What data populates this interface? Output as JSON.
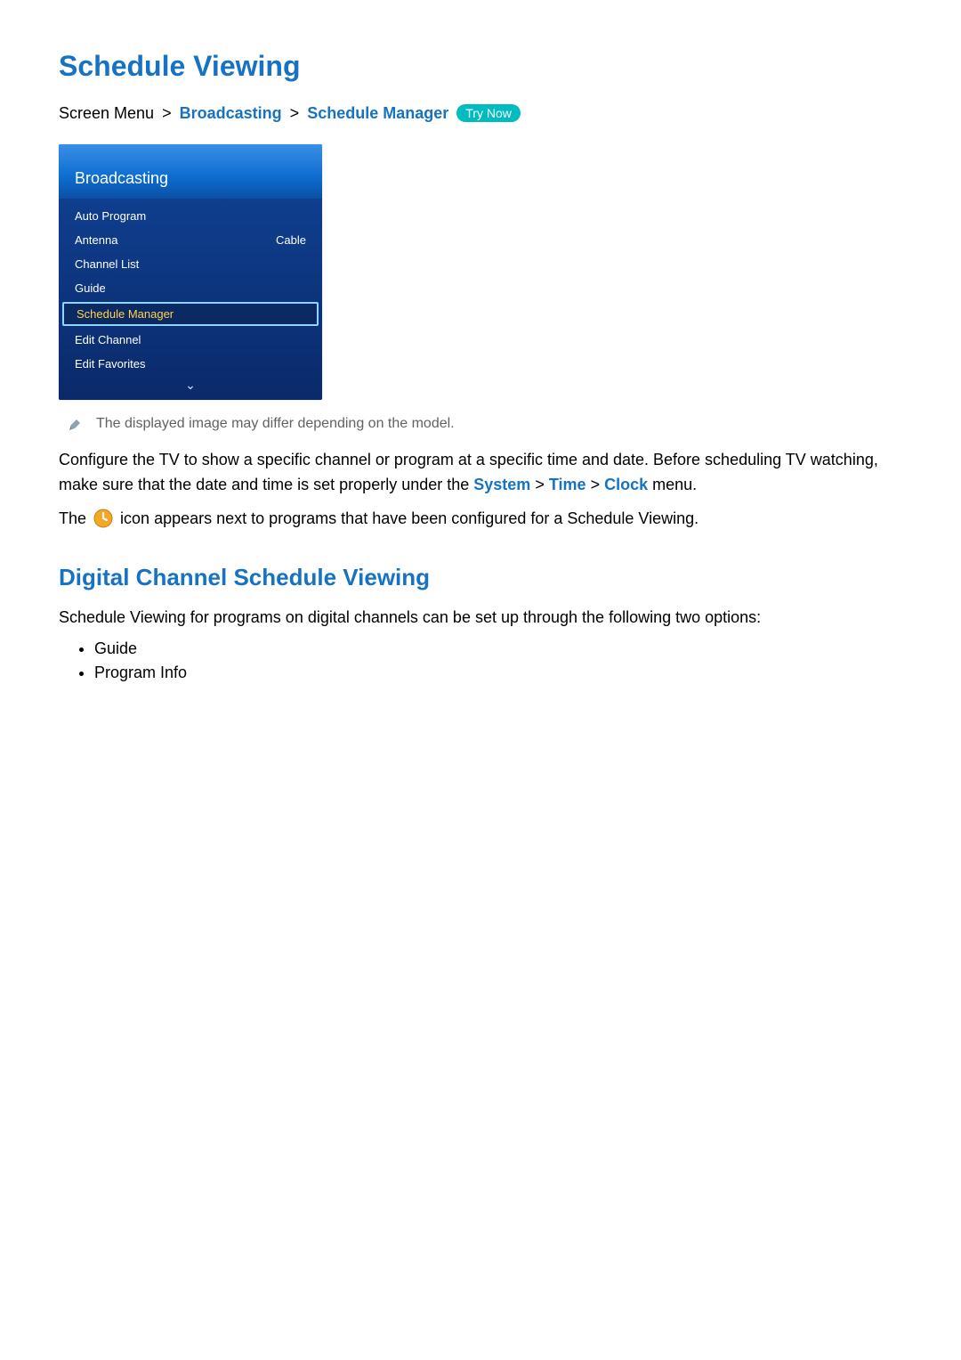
{
  "title": "Schedule Viewing",
  "breadcrumb": {
    "root": "Screen Menu",
    "sep": ">",
    "l1": "Broadcasting",
    "l2": "Schedule Manager",
    "try_now": "Try Now"
  },
  "tv_panel": {
    "header": "Broadcasting",
    "items": [
      {
        "label": "Auto Program",
        "value": ""
      },
      {
        "label": "Antenna",
        "value": "Cable"
      },
      {
        "label": "Channel List",
        "value": ""
      },
      {
        "label": "Guide",
        "value": ""
      },
      {
        "label": "Schedule Manager",
        "value": "",
        "selected": true
      },
      {
        "label": "Edit Channel",
        "value": ""
      },
      {
        "label": "Edit Favorites",
        "value": ""
      }
    ],
    "chevron": "⌄"
  },
  "note": "The displayed image may differ depending on the model.",
  "para1_a": "Configure the TV to show a specific channel or program at a specific time and date. Before scheduling TV watching, make sure that the date and time is set properly under the ",
  "para1_nav": {
    "a": "System",
    "sep": ">",
    "b": "Time",
    "c": "Clock"
  },
  "para1_b": " menu.",
  "para2_a": "The ",
  "para2_b": " icon appears next to programs that have been configured for a Schedule Viewing.",
  "section2_title": "Digital Channel Schedule Viewing",
  "section2_intro": "Schedule Viewing for programs on digital channels can be set up through the following two options:",
  "bullets": [
    "Guide",
    "Program Info"
  ]
}
